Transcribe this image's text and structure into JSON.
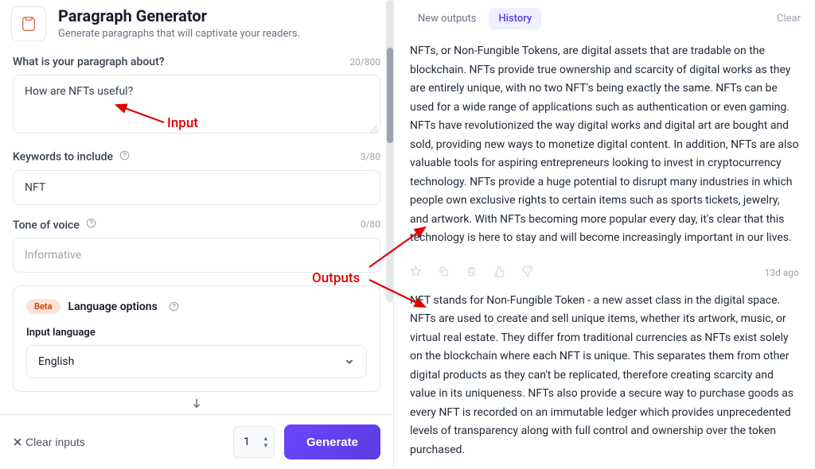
{
  "header": {
    "title": "Paragraph Generator",
    "subtitle": "Generate paragraphs that will captivate your readers."
  },
  "fields": {
    "topic": {
      "label": "What is your paragraph about?",
      "count": "20/800",
      "value": "How are NFTs useful?"
    },
    "keywords": {
      "label": "Keywords to include",
      "count": "3/80",
      "value": "NFT"
    },
    "tone": {
      "label": "Tone of voice",
      "count": "0/80",
      "placeholder": "Informative",
      "value": ""
    }
  },
  "language": {
    "badge": "Beta",
    "title": "Language options",
    "input_label": "Input language",
    "selected": "English"
  },
  "bottom": {
    "clear_label": "Clear inputs",
    "qty": "1",
    "generate_label": "Generate"
  },
  "tabs": {
    "new": "New outputs",
    "history": "History",
    "clear": "Clear"
  },
  "outputs": [
    {
      "text": "NFTs, or Non-Fungible Tokens, are digital assets that are tradable on the blockchain. NFTs provide true ownership and scarcity of digital works as they are entirely unique, with no two NFT's being exactly the same. NFTs can be used for a wide range of applications such as authentication or even gaming. NFTs have revolutionized the way digital works and digital art are bought and sold, providing new ways to monetize digital content. In addition, NFTs are also valuable tools for aspiring entrepreneurs looking to invest in cryptocurrency technology. NFTs provide a huge potential to disrupt many industries in which people own exclusive rights to certain items such as sports tickets, jewelry, and artwork. With NFTs becoming more popular every day, it's clear that this technology is here to stay and will become increasingly important in our lives.",
      "timestamp": "13d ago"
    },
    {
      "text": "NFT stands for Non-Fungible Token - a new asset class in the digital space. NFTs are used to create and sell unique items, whether its artwork, music, or virtual real estate. They differ from traditional currencies as NFTs exist solely on the blockchain where each NFT is unique. This separates them from other digital products as they can't be replicated, therefore creating scarcity and value in its uniqueness. NFTs also provide a secure way to purchase goods as every NFT is recorded on an immutable ledger which provides unprecedented levels of transparency along with full control and ownership over the token purchased."
    }
  ],
  "annotations": {
    "input": "Input",
    "outputs": "Outputs"
  }
}
